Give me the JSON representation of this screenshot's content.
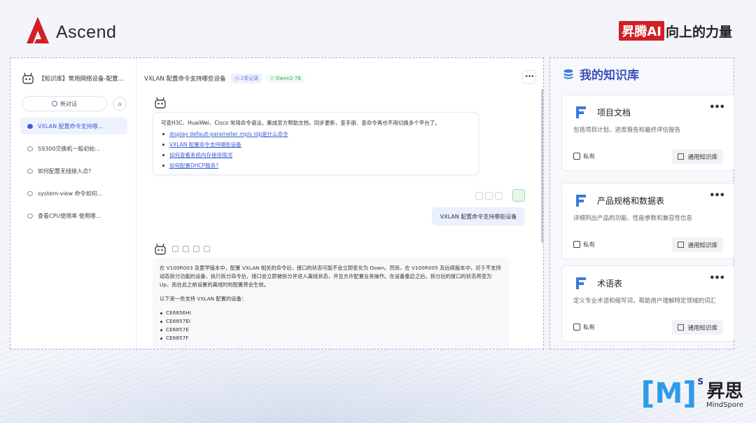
{
  "header": {
    "brand": "Ascend",
    "slogan_highlight": "昇腾AI",
    "slogan_rest": "向上的力量"
  },
  "sidebar": {
    "title": "【知识库】常用网络设备-配置...",
    "new_chat": "新对话",
    "items": [
      {
        "label": "VXLAN 配置命令支持哪..."
      },
      {
        "label": "S9300交换机一般初始..."
      },
      {
        "label": "如何配置无线接入点?"
      },
      {
        "label": "system-view 命令如何..."
      },
      {
        "label": "查看CPU使用率 使用哪..."
      }
    ]
  },
  "chat": {
    "title": "VXLAN 配置命令支持哪些设备",
    "records_tag": "2条记录",
    "model_tag": "Qwen2-7B",
    "intro": "可查H3C、HuaiWei、Cisco 常用命令语法。集成官方帮助文档，同步更新，查手册、查命令再也不用切换多个平台了。",
    "suggestions": [
      "display default-parameter mpls ldp是什么命令",
      "VXLAN 配置命令支持哪些设备",
      "如何查看系统内存使用情况",
      "如何配置DHCP服务?"
    ],
    "user_message": "VXLAN 配置命令支持哪些设备",
    "answer_p1": "在 V100R003 及更早版本中，配置 VXLAN 相关的命令后，接口的状态可能不会立即变化为 Down。然而，在 V100R005 及后续版本中，对于不支持动态拆分功能的设备，执行拆分命令后，接口会立即被拆分并进入离线状态，并且允许配置业务操作。在设备重启之后，拆分后的接口的状态将变为 Up，而在此之前设置的离线时的配置将会生效。",
    "answer_p2": "以下是一些支持 VXLAN 配置的设备：",
    "answer_devices": [
      "CE6856HI",
      "CE6857EI",
      "CE6857E",
      "CE6857F"
    ]
  },
  "knowledge": {
    "title": "我的知识库",
    "cards": [
      {
        "name": "项目文档",
        "desc": "包括项目计划、进度报告和最终评估报告",
        "privacy": "私有",
        "type": "通用知识库"
      },
      {
        "name": "产品规格和数据表",
        "desc": "详细列出产品的功能、性能参数和兼容性信息",
        "privacy": "私有",
        "type": "通用知识库"
      },
      {
        "name": "术语表",
        "desc": "定义专业术语和缩写词，帮助用户理解特定领域的词汇",
        "privacy": "私有",
        "type": "通用知识库"
      }
    ]
  },
  "mindspore": {
    "bracket_left": "[",
    "m": "M",
    "bracket_right": "]",
    "sup": "S",
    "cn": "昇思",
    "en": "MindSpore"
  }
}
